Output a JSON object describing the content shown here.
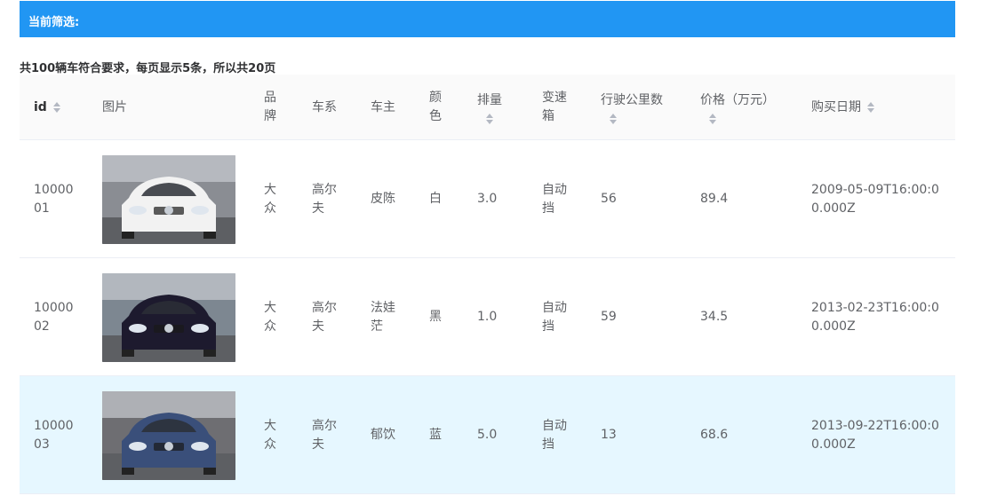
{
  "filter": {
    "label": "当前筛选:"
  },
  "summary": "共100辆车符合要求，每页显示5条，所以共20页",
  "columns": {
    "id": "id",
    "image": "图片",
    "brand": "品牌",
    "series": "车系",
    "owner": "车主",
    "color": "颜色",
    "displacement": "排量",
    "transmission": "变速箱",
    "mileage": "行驶公里数",
    "price": "价格（万元）",
    "purchase_date": "购买日期"
  },
  "rows": [
    {
      "id": "1000001",
      "brand": "大众",
      "series": "高尔夫",
      "owner": "皮陈",
      "color": "白",
      "displacement": "3.0",
      "transmission": "自动挡",
      "mileage": "56",
      "price": "89.4",
      "purchase_date": "2009-05-09T16:00:00.000Z",
      "car_color": "#f2f2f2",
      "bg": "#8a8d93"
    },
    {
      "id": "1000002",
      "brand": "大众",
      "series": "高尔夫",
      "owner": "法娃茫",
      "color": "黑",
      "displacement": "1.0",
      "transmission": "自动挡",
      "mileage": "59",
      "price": "34.5",
      "purchase_date": "2013-02-23T16:00:00.000Z",
      "car_color": "#1d1a2e",
      "bg": "#7d8791"
    },
    {
      "id": "1000003",
      "brand": "大众",
      "series": "高尔夫",
      "owner": "郁饮",
      "color": "蓝",
      "displacement": "5.0",
      "transmission": "自动挡",
      "mileage": "13",
      "price": "68.6",
      "purchase_date": "2013-09-22T16:00:00.000Z",
      "car_color": "#3a4f7a",
      "bg": "#6e6e72",
      "highlight": true
    }
  ]
}
